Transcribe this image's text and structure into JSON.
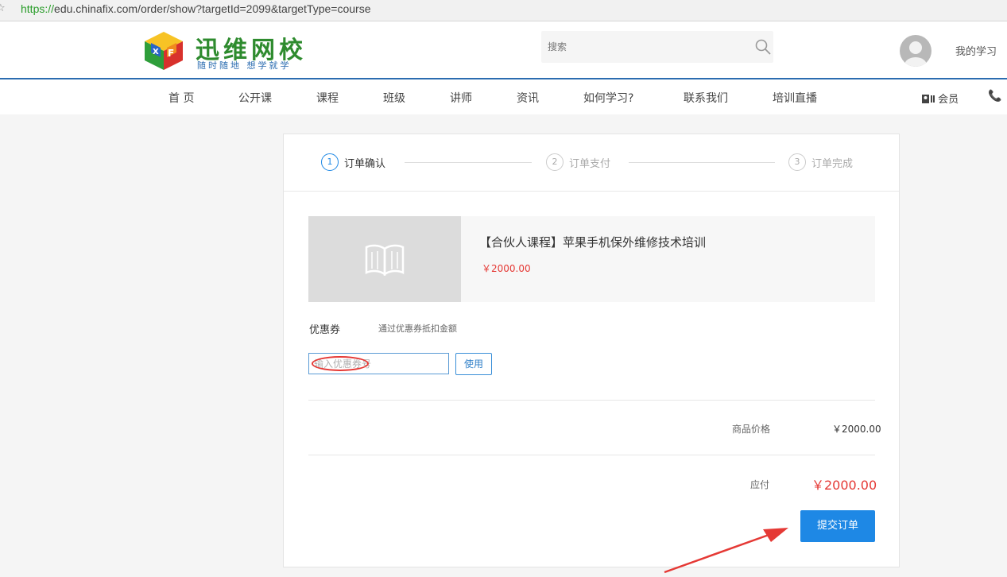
{
  "browser": {
    "url_scheme": "https://",
    "url_rest": "edu.chinafix.com/order/show?targetId=2099&targetType=course"
  },
  "header": {
    "logo_title": "迅维网校",
    "logo_slogan": "随时随地 想学就学",
    "search_placeholder": "搜索",
    "my_study": "我的学习"
  },
  "nav": {
    "items": [
      "首 页",
      "公开课",
      "课程",
      "班级",
      "讲师",
      "资讯",
      "如何学习?",
      "联系我们",
      "培训直播"
    ],
    "member": "会员"
  },
  "steps": [
    {
      "num": "1",
      "label": "订单确认",
      "active": true
    },
    {
      "num": "2",
      "label": "订单支付",
      "active": false
    },
    {
      "num": "3",
      "label": "订单完成",
      "active": false
    }
  ],
  "product": {
    "name": "【合伙人课程】苹果手机保外维修技术培训",
    "price": "￥2000.00"
  },
  "coupon": {
    "label": "优惠券",
    "hint": "通过优惠券抵扣金额",
    "placeholder": "输入优惠券号",
    "use_button": "使用"
  },
  "summary": {
    "price_label": "商品价格",
    "price_value": "￥2000.00",
    "due_label": "应付",
    "due_value": "￥2000.00"
  },
  "submit_button": "提交订单",
  "colors": {
    "accent": "#1e88e5",
    "price_red": "#e53935",
    "logo_green": "#2e8b2e",
    "header_line": "#2b6cb0"
  }
}
